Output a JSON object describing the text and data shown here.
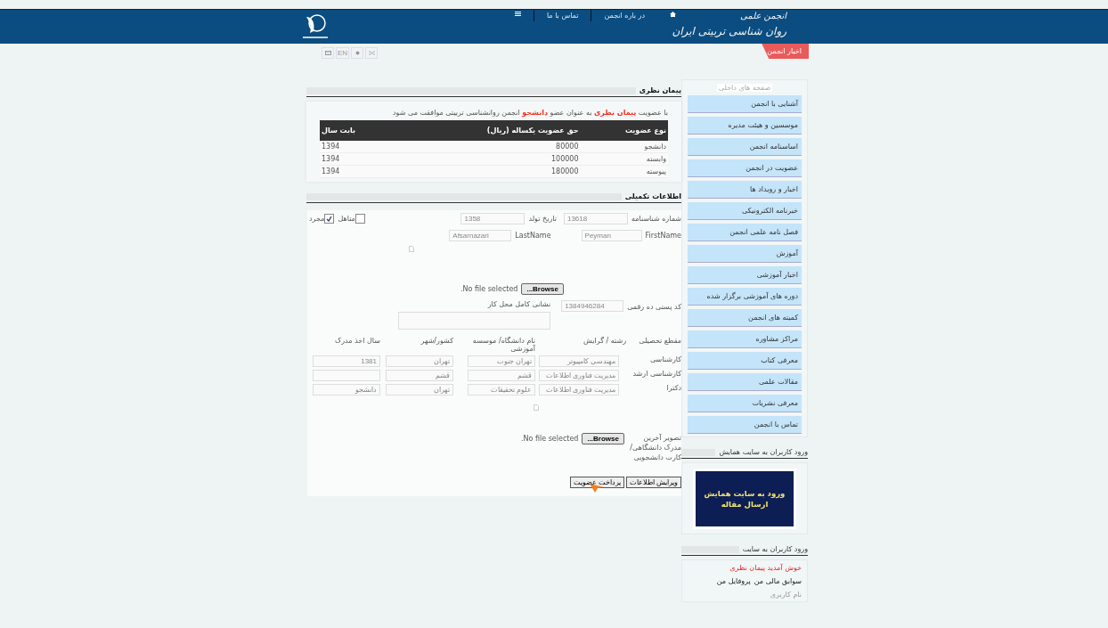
{
  "header": {
    "title_lines": [
      "انجمن علمی",
      "روان شناسی تربیتی ایران"
    ],
    "nav": [
      {
        "kind": "home"
      },
      {
        "kind": "text",
        "label": "در باره انجمن"
      },
      {
        "kind": "text",
        "label": "تماس با ما"
      },
      {
        "kind": "menu"
      }
    ]
  },
  "toolbar": {
    "tag": "اخبار انجمن",
    "buttons": [
      {
        "kind": "shuffle"
      },
      {
        "kind": "settings"
      },
      {
        "kind": "text",
        "label": "EN"
      },
      {
        "kind": "mail"
      }
    ]
  },
  "membership": {
    "title": "پیمان نظری",
    "note": [
      {
        "text": "با عضویت ",
        "highlight": false
      },
      {
        "text": "پیمان نظری",
        "highlight": true
      },
      {
        "text": " به عنوان عضو ",
        "highlight": false
      },
      {
        "text": "دانشجو",
        "highlight": true
      },
      {
        "text": " انجمن روانشناسی تربیتی موافقت می شود",
        "highlight": false
      }
    ],
    "columns": [
      "نوع عضویت",
      "حق عضویت یکساله (ریال)",
      "بابت سال"
    ],
    "rows": [
      [
        "دانشجو",
        "80000",
        "1394"
      ],
      [
        "وابسته",
        "100000",
        "1394"
      ],
      [
        "پیوسته",
        "180000",
        "1394"
      ]
    ]
  },
  "details": {
    "title": "اطلاعات تکمیلی",
    "id_number": {
      "label": "شماره شناسنامه",
      "value": "13618"
    },
    "birth_date": {
      "label": "تاریخ تولد",
      "value": "1358"
    },
    "marital": [
      {
        "label": "متاهل",
        "checked": false
      },
      {
        "label": "مجرد",
        "checked": true
      }
    ],
    "first_name": {
      "label": "FirstName",
      "value": "Peyman"
    },
    "last_name": {
      "label": "LastName",
      "value": "Afsarnazari"
    },
    "photo_upload": {
      "status": "No file selected.",
      "button": "Browse..."
    },
    "postal_code": {
      "label": "کد پستی ده رقمی",
      "value": "1384946284"
    },
    "work_address": {
      "label": "نشانی کامل محل کار"
    },
    "education": {
      "columns": [
        "مقطع تحصیلی",
        "رشته / گرایش",
        "نام دانشگاه/ موسسه آموزشی",
        "کشور/شهر",
        "سال اخذ مدرک"
      ],
      "rows": [
        [
          "کارشناسی",
          "مهندسی کامپیوتر",
          "تهران جنوب",
          "تهران",
          "1381"
        ],
        [
          "کارشناسی ارشد",
          "مدیریت فناوری اطلاعات",
          "قشم",
          "قشم",
          ""
        ],
        [
          "دکترا",
          "مدیریت فناوری اطلاعات",
          "علوم تحقیقات",
          "تهران",
          "دانشجو"
        ]
      ]
    },
    "document_upload": {
      "label": "تصویر آخرین مدرک دانشگاهی/ کارت دانشجویی",
      "status": "No file selected.",
      "button": "Browse..."
    },
    "buttons": [
      "ویرایش اطلاعات",
      "پرداخت عضویت"
    ]
  },
  "sidebar": {
    "title": "صفحه های داخلی",
    "items": [
      "آشنایی با انجمن",
      "موسسین و هیئت مدیره",
      "اساسنامه انجمن",
      "عضویت در انجمن",
      "اخبار و رویداد ها",
      "خبرنامه الکترونیکی",
      "فصل نامه علمی انجمن",
      "آموزش",
      "اخبار آموزشی",
      "دوره های آموزشی برگزار شده",
      "کمیته های انجمن",
      "مراکز مشاوره",
      "معرفی کتاب",
      "مقالات علمی",
      "معرفی نشریات",
      "تماس با انجمن"
    ]
  },
  "conference": {
    "title": "ورود کاربران به سایت همایش",
    "banner_lines": [
      "ورود به سایت همایش",
      "ارسال مقاله"
    ]
  },
  "login": {
    "title": "ورود کاربران به سایت",
    "welcome": "خوش آمدید پیمان نظری",
    "links": [
      "سوابق مالی من",
      "پروفایل من"
    ],
    "username_label": "نام کاربری"
  }
}
